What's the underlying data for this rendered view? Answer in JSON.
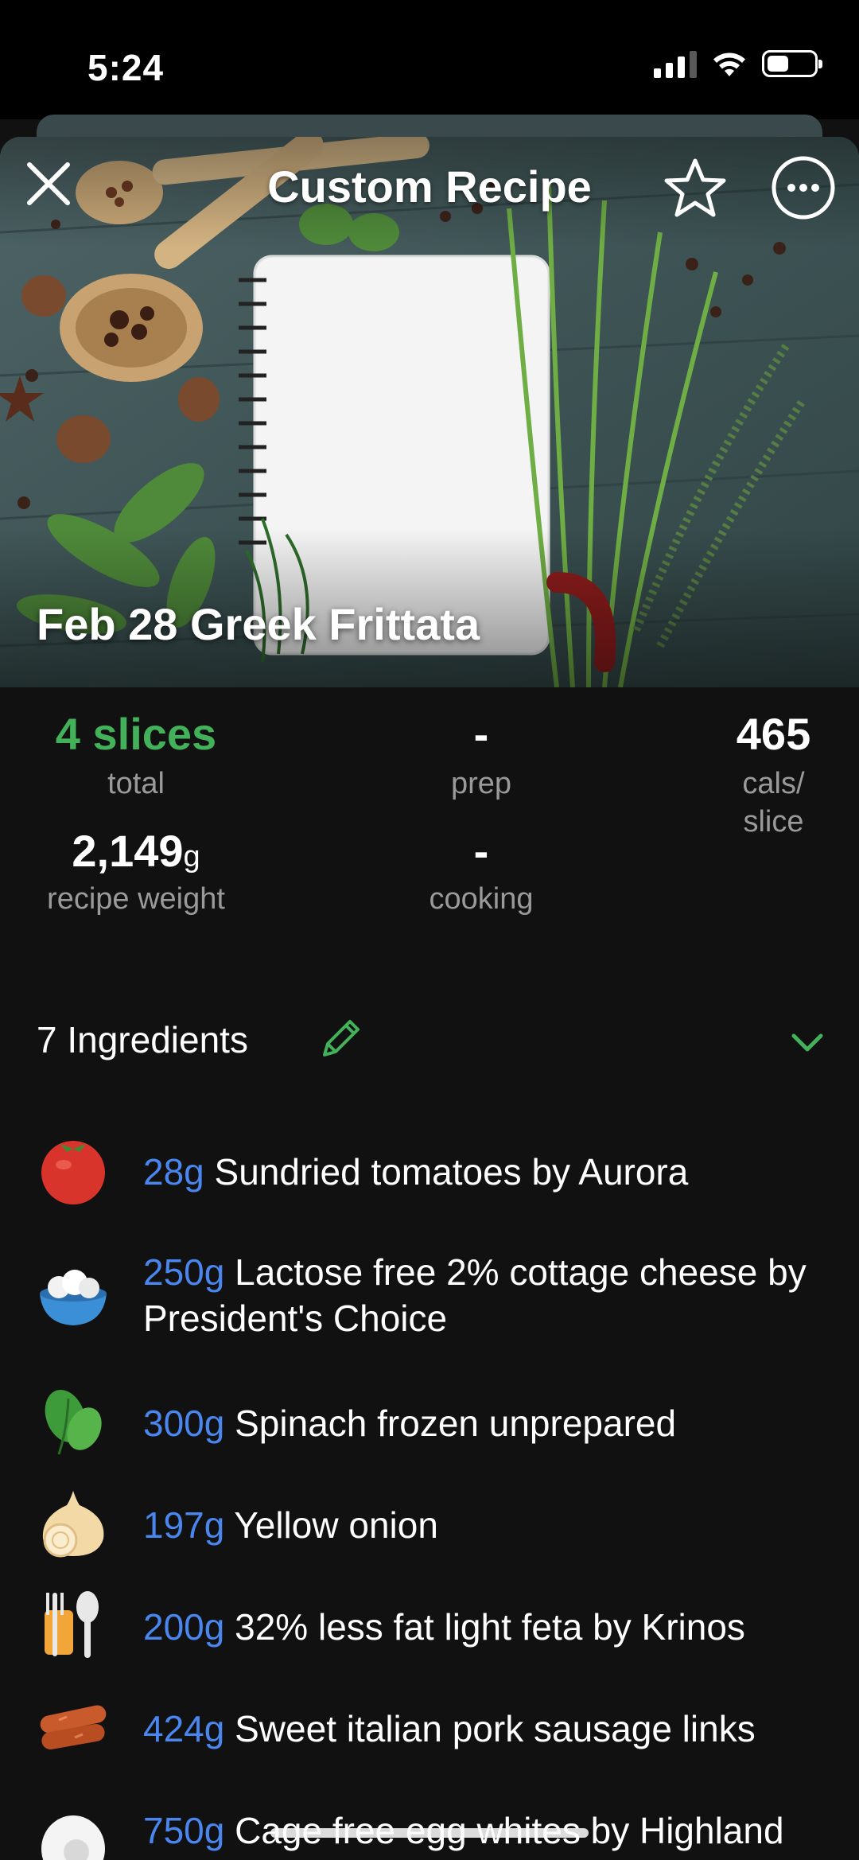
{
  "status_bar": {
    "time": "5:24"
  },
  "nav": {
    "title": "Custom Recipe"
  },
  "recipe": {
    "title": "Feb 28 Greek Frittata"
  },
  "stats": {
    "servings": {
      "value": "4 slices",
      "label": "total"
    },
    "prep": {
      "value": "-",
      "label": "prep"
    },
    "calories": {
      "value": "465",
      "label_line1": "cals/",
      "label_line2": "slice"
    },
    "weight": {
      "value": "2,149",
      "unit": "g",
      "label": "recipe weight"
    },
    "cooking": {
      "value": "-",
      "label": "cooking"
    }
  },
  "ingredients_header": {
    "label": "7 Ingredients"
  },
  "ingredients": [
    {
      "qty": "28g",
      "name": "Sundried tomatoes by Aurora",
      "icon": "tomato-icon"
    },
    {
      "qty": "250g",
      "name": "Lactose free 2% cottage cheese by President's Choice",
      "icon": "cottage-cheese-bowl-icon"
    },
    {
      "qty": "300g",
      "name": "Spinach frozen unprepared",
      "icon": "spinach-icon"
    },
    {
      "qty": "197g",
      "name": "Yellow onion",
      "icon": "onion-icon"
    },
    {
      "qty": "200g",
      "name": "32% less fat light feta by Krinos",
      "icon": "utensils-icon"
    },
    {
      "qty": "424g",
      "name": "Sweet italian pork sausage links",
      "icon": "sausage-icon"
    },
    {
      "qty": "750g",
      "name": "Cage free egg whites by Highland Gold",
      "icon": "egg-icon"
    }
  ],
  "colors": {
    "accent_green": "#43b15a",
    "quantity_blue": "#4a86f0",
    "background": "#111111"
  }
}
